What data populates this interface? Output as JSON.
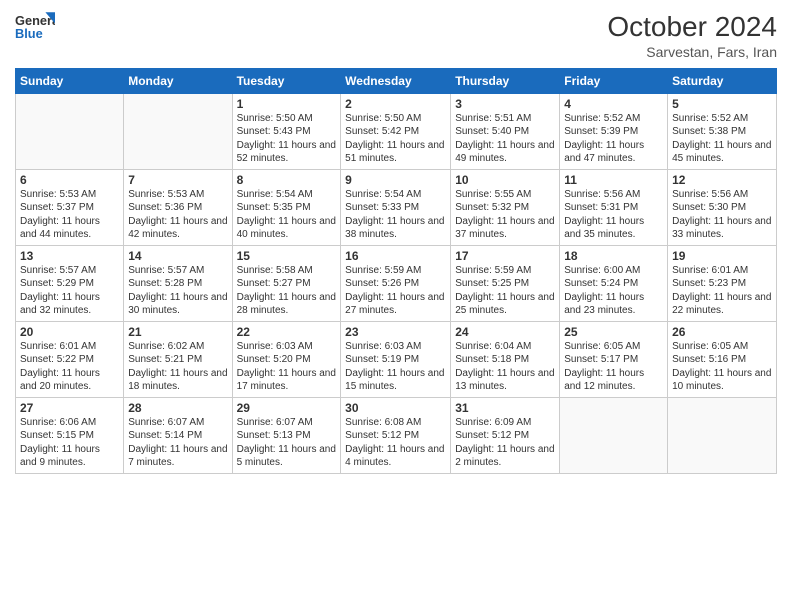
{
  "header": {
    "logo_line1": "General",
    "logo_line2": "Blue",
    "month": "October 2024",
    "location": "Sarvestan, Fars, Iran"
  },
  "days_of_week": [
    "Sunday",
    "Monday",
    "Tuesday",
    "Wednesday",
    "Thursday",
    "Friday",
    "Saturday"
  ],
  "weeks": [
    [
      {
        "day": "",
        "info": ""
      },
      {
        "day": "",
        "info": ""
      },
      {
        "day": "1",
        "info": "Sunrise: 5:50 AM\nSunset: 5:43 PM\nDaylight: 11 hours\nand 52 minutes."
      },
      {
        "day": "2",
        "info": "Sunrise: 5:50 AM\nSunset: 5:42 PM\nDaylight: 11 hours\nand 51 minutes."
      },
      {
        "day": "3",
        "info": "Sunrise: 5:51 AM\nSunset: 5:40 PM\nDaylight: 11 hours\nand 49 minutes."
      },
      {
        "day": "4",
        "info": "Sunrise: 5:52 AM\nSunset: 5:39 PM\nDaylight: 11 hours\nand 47 minutes."
      },
      {
        "day": "5",
        "info": "Sunrise: 5:52 AM\nSunset: 5:38 PM\nDaylight: 11 hours\nand 45 minutes."
      }
    ],
    [
      {
        "day": "6",
        "info": "Sunrise: 5:53 AM\nSunset: 5:37 PM\nDaylight: 11 hours\nand 44 minutes."
      },
      {
        "day": "7",
        "info": "Sunrise: 5:53 AM\nSunset: 5:36 PM\nDaylight: 11 hours\nand 42 minutes."
      },
      {
        "day": "8",
        "info": "Sunrise: 5:54 AM\nSunset: 5:35 PM\nDaylight: 11 hours\nand 40 minutes."
      },
      {
        "day": "9",
        "info": "Sunrise: 5:54 AM\nSunset: 5:33 PM\nDaylight: 11 hours\nand 38 minutes."
      },
      {
        "day": "10",
        "info": "Sunrise: 5:55 AM\nSunset: 5:32 PM\nDaylight: 11 hours\nand 37 minutes."
      },
      {
        "day": "11",
        "info": "Sunrise: 5:56 AM\nSunset: 5:31 PM\nDaylight: 11 hours\nand 35 minutes."
      },
      {
        "day": "12",
        "info": "Sunrise: 5:56 AM\nSunset: 5:30 PM\nDaylight: 11 hours\nand 33 minutes."
      }
    ],
    [
      {
        "day": "13",
        "info": "Sunrise: 5:57 AM\nSunset: 5:29 PM\nDaylight: 11 hours\nand 32 minutes."
      },
      {
        "day": "14",
        "info": "Sunrise: 5:57 AM\nSunset: 5:28 PM\nDaylight: 11 hours\nand 30 minutes."
      },
      {
        "day": "15",
        "info": "Sunrise: 5:58 AM\nSunset: 5:27 PM\nDaylight: 11 hours\nand 28 minutes."
      },
      {
        "day": "16",
        "info": "Sunrise: 5:59 AM\nSunset: 5:26 PM\nDaylight: 11 hours\nand 27 minutes."
      },
      {
        "day": "17",
        "info": "Sunrise: 5:59 AM\nSunset: 5:25 PM\nDaylight: 11 hours\nand 25 minutes."
      },
      {
        "day": "18",
        "info": "Sunrise: 6:00 AM\nSunset: 5:24 PM\nDaylight: 11 hours\nand 23 minutes."
      },
      {
        "day": "19",
        "info": "Sunrise: 6:01 AM\nSunset: 5:23 PM\nDaylight: 11 hours\nand 22 minutes."
      }
    ],
    [
      {
        "day": "20",
        "info": "Sunrise: 6:01 AM\nSunset: 5:22 PM\nDaylight: 11 hours\nand 20 minutes."
      },
      {
        "day": "21",
        "info": "Sunrise: 6:02 AM\nSunset: 5:21 PM\nDaylight: 11 hours\nand 18 minutes."
      },
      {
        "day": "22",
        "info": "Sunrise: 6:03 AM\nSunset: 5:20 PM\nDaylight: 11 hours\nand 17 minutes."
      },
      {
        "day": "23",
        "info": "Sunrise: 6:03 AM\nSunset: 5:19 PM\nDaylight: 11 hours\nand 15 minutes."
      },
      {
        "day": "24",
        "info": "Sunrise: 6:04 AM\nSunset: 5:18 PM\nDaylight: 11 hours\nand 13 minutes."
      },
      {
        "day": "25",
        "info": "Sunrise: 6:05 AM\nSunset: 5:17 PM\nDaylight: 11 hours\nand 12 minutes."
      },
      {
        "day": "26",
        "info": "Sunrise: 6:05 AM\nSunset: 5:16 PM\nDaylight: 11 hours\nand 10 minutes."
      }
    ],
    [
      {
        "day": "27",
        "info": "Sunrise: 6:06 AM\nSunset: 5:15 PM\nDaylight: 11 hours\nand 9 minutes."
      },
      {
        "day": "28",
        "info": "Sunrise: 6:07 AM\nSunset: 5:14 PM\nDaylight: 11 hours\nand 7 minutes."
      },
      {
        "day": "29",
        "info": "Sunrise: 6:07 AM\nSunset: 5:13 PM\nDaylight: 11 hours\nand 5 minutes."
      },
      {
        "day": "30",
        "info": "Sunrise: 6:08 AM\nSunset: 5:12 PM\nDaylight: 11 hours\nand 4 minutes."
      },
      {
        "day": "31",
        "info": "Sunrise: 6:09 AM\nSunset: 5:12 PM\nDaylight: 11 hours\nand 2 minutes."
      },
      {
        "day": "",
        "info": ""
      },
      {
        "day": "",
        "info": ""
      }
    ]
  ]
}
